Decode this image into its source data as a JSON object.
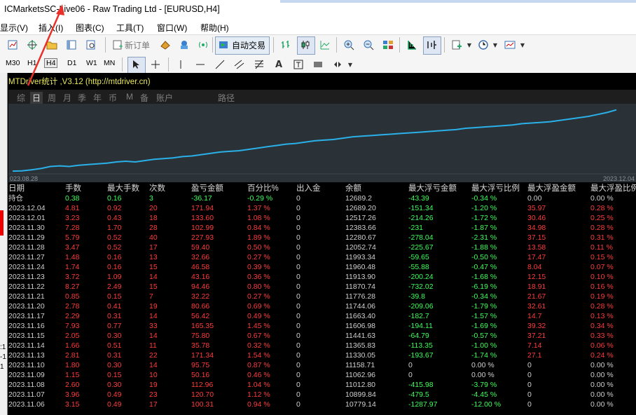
{
  "window": {
    "title": "ICMarketsSC-Live06 - Raw Trading Ltd - [EURUSD,H4]"
  },
  "menu": [
    "显示(V)",
    "插入(I)",
    "图表(C)",
    "工具(T)",
    "窗口(W)",
    "帮助(H)"
  ],
  "toolbar": {
    "new_order_label": "新订单",
    "auto_trade_label": "自动交易"
  },
  "timeframes": [
    "M30",
    "H1",
    "H4",
    "D1",
    "W1",
    "MN"
  ],
  "selected_timeframe": "H4",
  "drawing_text_tool": "A",
  "panel": {
    "title": "MTDriver统计 ,V3.12 (http://mtdriver.cn)",
    "tabs": [
      "综",
      "日",
      "周",
      "月",
      "季",
      "年",
      "币",
      "M",
      "备",
      "账户",
      "路径"
    ],
    "selected_tab": "日"
  },
  "chart_data": {
    "type": "area",
    "x_start_label": "023.08.28",
    "x_end_label": "2023.12.04",
    "series_color": "#2ab0e8",
    "y_points": [
      0.02,
      0.025,
      0.04,
      0.06,
      0.09,
      0.1,
      0.09,
      0.11,
      0.12,
      0.13,
      0.14,
      0.16,
      0.17,
      0.16,
      0.18,
      0.2,
      0.21,
      0.22,
      0.24,
      0.25,
      0.27,
      0.29,
      0.31,
      0.32,
      0.33,
      0.35,
      0.37,
      0.39,
      0.41,
      0.43,
      0.44,
      0.46,
      0.48,
      0.49,
      0.5,
      0.52,
      0.54,
      0.55,
      0.56,
      0.57,
      0.58,
      0.59,
      0.6,
      0.61,
      0.62,
      0.63,
      0.64,
      0.65,
      0.67,
      0.68,
      0.69,
      0.7,
      0.71,
      0.72,
      0.74,
      0.75,
      0.76,
      0.77,
      0.79,
      0.81,
      0.83,
      0.85,
      0.88,
      0.91,
      0.95
    ]
  },
  "table": {
    "headers": [
      "日期",
      "手数",
      "最大手数",
      "次数",
      "盈亏金额",
      "百分比%",
      "出入金",
      "余额",
      "最大浮亏金额",
      "最大浮亏比例",
      "最大浮盈金额",
      "最大浮盈比例"
    ],
    "hold_row": [
      "持仓",
      "0.38",
      "0.16",
      "3",
      "-36.17",
      "-0.29 %",
      "0",
      "12689.2",
      "-43.39",
      "-0.34 %",
      "0.00",
      "0.00 %"
    ],
    "rows": [
      [
        "2023.12.04",
        "4.81",
        "0.92",
        "20",
        "171.94",
        "1.37 %",
        "0",
        "12689.20",
        "-151.34",
        "-1.20 %",
        "35.97",
        "0.28 %"
      ],
      [
        "2023.12.01",
        "3.23",
        "0.43",
        "18",
        "133.60",
        "1.08 %",
        "0",
        "12517.26",
        "-214.26",
        "-1.72 %",
        "30.46",
        "0.25 %"
      ],
      [
        "2023.11.30",
        "7.28",
        "1.70",
        "28",
        "102.99",
        "0.84 %",
        "0",
        "12383.66",
        "-231",
        "-1.87 %",
        "34.98",
        "0.28 %"
      ],
      [
        "2023.11.29",
        "5.79",
        "0.52",
        "40",
        "227.93",
        "1.89 %",
        "0",
        "12280.67",
        "-278.04",
        "-2.31 %",
        "37.15",
        "0.31 %"
      ],
      [
        "2023.11.28",
        "3.47",
        "0.52",
        "17",
        "59.40",
        "0.50 %",
        "0",
        "12052.74",
        "-225.67",
        "-1.88 %",
        "13.58",
        "0.11 %"
      ],
      [
        "2023.11.27",
        "1.48",
        "0.16",
        "13",
        "32.66",
        "0.27 %",
        "0",
        "11993.34",
        "-59.65",
        "-0.50 %",
        "17.47",
        "0.15 %"
      ],
      [
        "2023.11.24",
        "1.74",
        "0.16",
        "15",
        "46.58",
        "0.39 %",
        "0",
        "11960.48",
        "-55.88",
        "-0.47 %",
        "8.04",
        "0.07 %"
      ],
      [
        "2023.11.23",
        "3.72",
        "1.09",
        "14",
        "43.16",
        "0.36 %",
        "0",
        "11913.90",
        "-200.24",
        "-1.68 %",
        "12.15",
        "0.10 %"
      ],
      [
        "2023.11.22",
        "8.27",
        "2.49",
        "15",
        "94.46",
        "0.80 %",
        "0",
        "11870.74",
        "-732.02",
        "-6.19 %",
        "18.91",
        "0.16 %"
      ],
      [
        "2023.11.21",
        "0.85",
        "0.15",
        "7",
        "32.22",
        "0.27 %",
        "0",
        "11776.28",
        "-39.8",
        "-0.34 %",
        "21.67",
        "0.19 %"
      ],
      [
        "2023.11.20",
        "2.78",
        "0.41",
        "19",
        "80.66",
        "0.69 %",
        "0",
        "11744.06",
        "-209.06",
        "-1.79 %",
        "32.61",
        "0.28 %"
      ],
      [
        "2023.11.17",
        "2.29",
        "0.31",
        "14",
        "56.42",
        "0.49 %",
        "0",
        "11663.40",
        "-182.7",
        "-1.57 %",
        "14.7",
        "0.13 %"
      ],
      [
        "2023.11.16",
        "7.93",
        "0.77",
        "33",
        "165.35",
        "1.45 %",
        "0",
        "11606.98",
        "-194.11",
        "-1.69 %",
        "39.32",
        "0.34 %"
      ],
      [
        "2023.11.15",
        "2.05",
        "0.30",
        "14",
        "75.80",
        "0.67 %",
        "0",
        "11441.63",
        "-64.79",
        "-0.57 %",
        "37.21",
        "0.33 %"
      ],
      [
        "2023.11.14",
        "1.66",
        "0.51",
        "11",
        "35.78",
        "0.32 %",
        "0",
        "11365.83",
        "-113.35",
        "-1.00 %",
        "7.14",
        "0.06 %"
      ],
      [
        "2023.11.13",
        "2.81",
        "0.31",
        "22",
        "171.34",
        "1.54 %",
        "0",
        "11330.05",
        "-193.67",
        "-1.74 %",
        "27.1",
        "0.24 %"
      ],
      [
        "2023.11.10",
        "1.80",
        "0.30",
        "14",
        "95.75",
        "0.87 %",
        "0",
        "11158.71",
        "0",
        "0.00 %",
        "0",
        "0.00 %"
      ],
      [
        "2023.11.09",
        "1.15",
        "0.15",
        "10",
        "50.16",
        "0.46 %",
        "0",
        "11062.96",
        "0",
        "0.00 %",
        "0",
        "0.00 %"
      ],
      [
        "2023.11.08",
        "2.60",
        "0.30",
        "19",
        "112.96",
        "1.04 %",
        "0",
        "11012.80",
        "-415.98",
        "-3.79 %",
        "0",
        "0.00 %"
      ],
      [
        "2023.11.07",
        "3.96",
        "0.49",
        "23",
        "120.70",
        "1.12 %",
        "0",
        "10899.84",
        "-479.5",
        "-4.45 %",
        "0",
        "0.00 %"
      ],
      [
        "2023.11.06",
        "3.15",
        "0.49",
        "17",
        "100.31",
        "0.94 %",
        "0",
        "10779.14",
        "-1287.97",
        "-12.00 %",
        "0",
        "0.00 %"
      ]
    ]
  },
  "colors": {
    "positive": "#ff3b3b",
    "negative": "#3bff5a",
    "neutral": "#d0d0d0",
    "panel_bg": "#000000",
    "title": "#e8e85a"
  },
  "icons": [
    "new-chart-icon",
    "crosshair-icon",
    "folder-icon",
    "navigator-icon",
    "search-window-icon",
    "new-order-icon",
    "history-icon",
    "email-icon",
    "signal-icon",
    "auto-trade-icon",
    "bar-chart-icon",
    "candle-chart-icon",
    "line-chart-icon",
    "zoom-in-icon",
    "zoom-out-icon",
    "tile-windows-icon",
    "scroll-icon",
    "chart-shift-icon",
    "indicators-icon",
    "periods-icon",
    "templates-icon",
    "cursor-icon",
    "crosshair-tool-icon",
    "vertical-line-icon",
    "horizontal-line-icon",
    "trend-line-icon",
    "equidistant-channel-icon",
    "fibonacci-icon",
    "text-tool-icon",
    "text-label-icon",
    "arrow-tool-icon"
  ]
}
